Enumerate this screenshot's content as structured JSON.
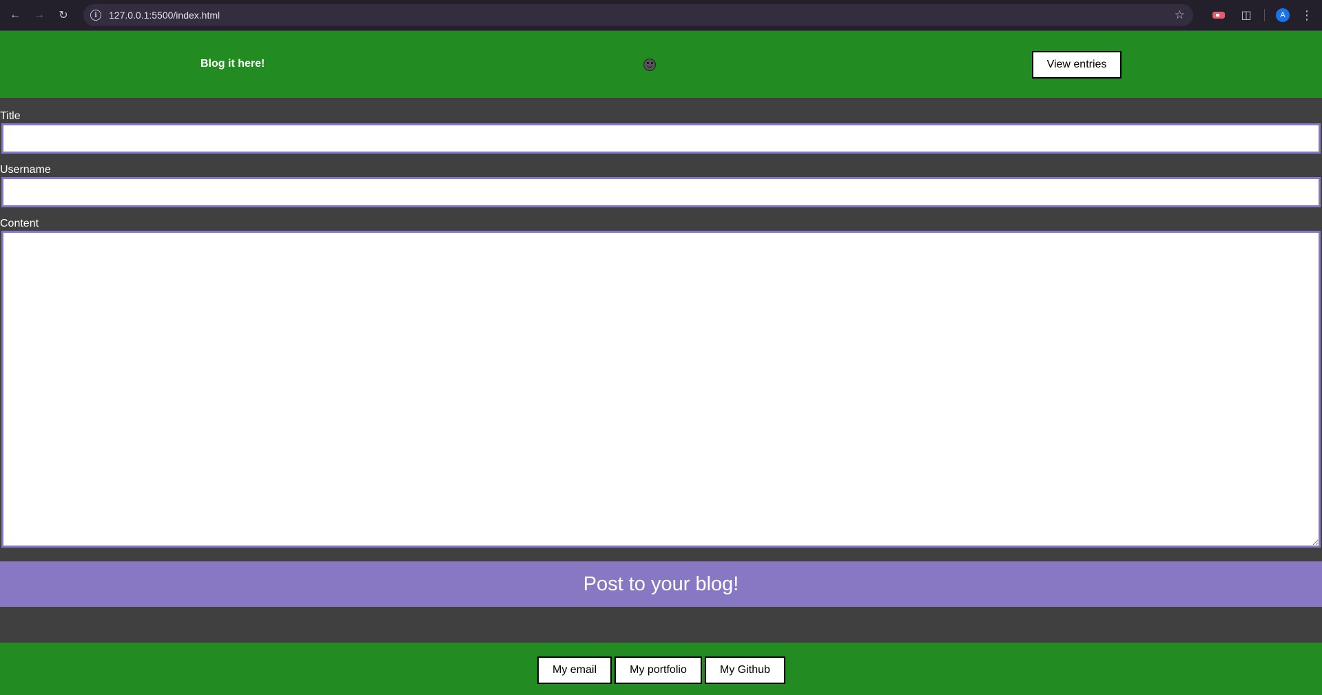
{
  "browser": {
    "url": "127.0.0.1:5500/index.html",
    "avatar_letter": "A",
    "icons": [
      "back-icon",
      "forward-icon",
      "reload-icon",
      "site-info-icon",
      "bookmark-star-icon",
      "extension-icon",
      "puzzle-icon",
      "menu-icon"
    ]
  },
  "header": {
    "title": "Blog it here!",
    "mode_toggle_icon": "smiley-icon",
    "view_entries_label": "View entries"
  },
  "form": {
    "title_label": "Title",
    "title_value": "",
    "username_label": "Username",
    "username_value": "",
    "content_label": "Content",
    "content_value": "",
    "submit_label": "Post to your blog!"
  },
  "footer": {
    "email_label": "My email",
    "portfolio_label": "My portfolio",
    "github_label": "My Github"
  },
  "colors": {
    "header_bg": "#228b22",
    "page_bg": "#404040",
    "accent": "#8878c3",
    "browser_bg": "#231f2b"
  }
}
